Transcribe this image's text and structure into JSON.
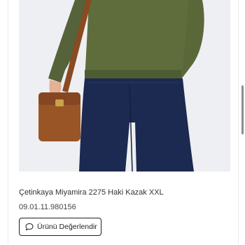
{
  "product": {
    "image_alt": "Çetinkaya Miyamira 2275 Haki Kazak XXL",
    "title": "Çetinkaya Miyamira 2275 Haki Kazak XXL",
    "code": "09.01.11.980156",
    "review_button_label": "Ürünü Değerlendir",
    "review_icon": "speech-bubble-icon"
  },
  "colors": {
    "sweater": "#5d6a3b",
    "jeans": "#1d2a52",
    "bag": "#9a5527",
    "background": "#eeeff2",
    "skin": "#e7b59c"
  }
}
